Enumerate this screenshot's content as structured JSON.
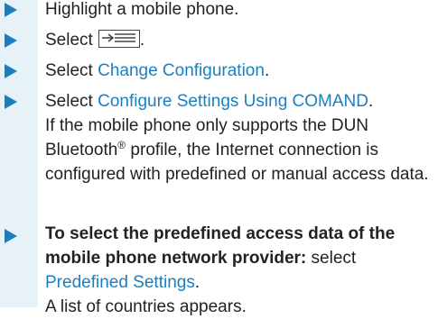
{
  "steps": [
    {
      "text": "Highlight a mobile phone."
    },
    {
      "prefix": "Select",
      "suffix": ".",
      "icon": "menu-icon"
    },
    {
      "prefix": "Select ",
      "link": "Change Configuration",
      "suffix": "."
    },
    {
      "prefix": "Select ",
      "link": "Configure Settings Using COMAND",
      "suffix": ".",
      "body_before_sup": "If the mobile phone only supports the DUN Bluetooth",
      "sup": "®",
      "body_after_sup": " profile, the Internet connection is configured with predefined or manual access data."
    },
    {
      "bold": "To select the predefined access data of the mobile phone network provider:",
      "text": " select ",
      "link": "Predefined Settings",
      "suffix": ".",
      "result": "A list of countries appears."
    }
  ],
  "colors": {
    "accent": "#1a7fc1",
    "bar": "#e6f1f8",
    "text": "#222222"
  }
}
